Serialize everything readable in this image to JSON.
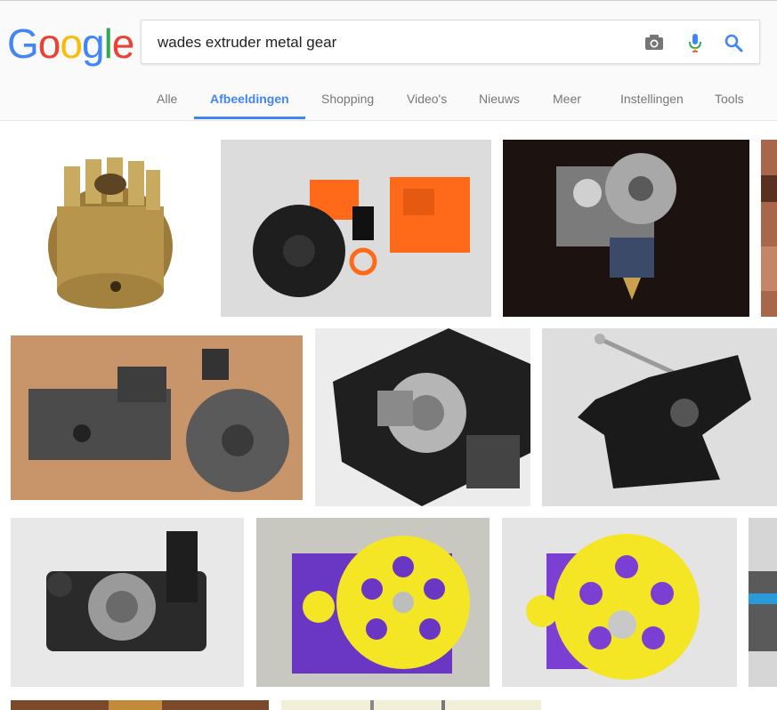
{
  "logo": {
    "letters": [
      "G",
      "o",
      "o",
      "g",
      "l",
      "e"
    ],
    "colors": [
      "#4285f4",
      "#ea4335",
      "#fbbc05",
      "#4285f4",
      "#34a853",
      "#ea4335"
    ]
  },
  "search": {
    "query": "wades extruder metal gear",
    "camera_icon": "camera-icon",
    "mic_icon": "microphone-icon",
    "search_icon": "search-icon"
  },
  "tabs": [
    {
      "label": "Alle",
      "active": false
    },
    {
      "label": "Afbeeldingen",
      "active": true
    },
    {
      "label": "Shopping",
      "active": false
    },
    {
      "label": "Video's",
      "active": false
    },
    {
      "label": "Nieuws",
      "active": false
    },
    {
      "label": "Meer",
      "active": false
    },
    {
      "label": "Instellingen",
      "active": false
    },
    {
      "label": "Tools",
      "active": false
    }
  ],
  "colors": {
    "accent": "#4285f4",
    "tab_text": "#777777"
  },
  "results": [
    {
      "subject": "brass pinion gear"
    },
    {
      "subject": "orange printed extruder parts with black gear"
    },
    {
      "subject": "metal extruder with large gear on dark background"
    },
    {
      "subject": "partial image"
    },
    {
      "subject": "grey printed extruder with large gear"
    },
    {
      "subject": "black extruder with bearing close-up"
    },
    {
      "subject": "black extruder body with rod"
    },
    {
      "subject": "black idler block with bearing"
    },
    {
      "subject": "purple extruder with yellow gear"
    },
    {
      "subject": "purple extruder with yellow gear close-up"
    },
    {
      "subject": "partial image"
    },
    {
      "subject": "partial image bottom row"
    },
    {
      "subject": "partial image bottom row"
    }
  ]
}
